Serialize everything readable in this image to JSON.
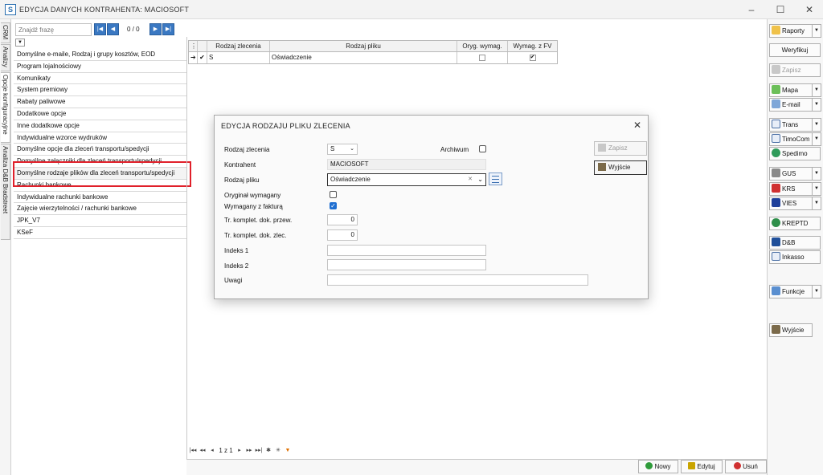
{
  "window": {
    "title": "EDYCJA DANYCH KONTRAHENTA: MACIOSOFT",
    "app_icon": "S"
  },
  "vtabs": [
    "CRM",
    "Analizy",
    "Opcje konfiguracyjne",
    "Analiza D&B Bradstreet"
  ],
  "search": {
    "placeholder": "Znajdź frazę",
    "count": "0 / 0"
  },
  "left_list": [
    "Domyślne e-maile, Rodzaj i grupy kosztów, EOD",
    "Program lojalnościowy",
    "Komunikaty",
    "System premiowy",
    "Rabaty paliwowe",
    "Dodatkowe opcje",
    "Inne dodatkowe opcje",
    "Indywidualne wzorce wydruków",
    "Domyślne opcje dla zleceń transportu/spedycji",
    "Domyślne załączniki dla zleceń transportu/spedycji",
    "Domyślne rodzaje plików dla zleceń transportu/spedycji",
    "Rachunki bankowe",
    "Indywidualne rachunki bankowe",
    "Zajęcie wierzytelności / rachunki bankowe",
    "JPK_V7",
    "KSeF"
  ],
  "grid": {
    "headers": [
      "",
      "",
      "Rodzaj zlecenia",
      "Rodzaj pliku",
      "Oryg. wymag.",
      "Wymag. z FV"
    ],
    "rows": [
      {
        "marker": "➔",
        "check": "✔",
        "rodzaj_zlecenia": "S",
        "rodzaj_pliku": "Oświadczenie",
        "oryg": false,
        "fv": true
      }
    ]
  },
  "bottom_nav": {
    "page": "1 z 1"
  },
  "bottom_buttons": {
    "new": "Nowy",
    "edit": "Edytuj",
    "delete": "Usuń"
  },
  "right_toolbar": {
    "raporty": "Raporty",
    "weryfikuj": "Weryfikuj",
    "zapisz": "Zapisz",
    "mapa": "Mapa",
    "email": "E-mail",
    "trans": "Trans",
    "timocom": "TimoCom",
    "spedimo": "Spedimo",
    "gus": "GUS",
    "krs": "KRS",
    "vies": "VIES",
    "kreptd": "KREPTD",
    "db": "D&B",
    "inkasso": "Inkasso",
    "funkcje": "Funkcje",
    "wyjscie": "Wyjście"
  },
  "modal": {
    "title": "EDYCJA RODZAJU PLIKU ZLECENIA",
    "rodzaj_zlecenia_label": "Rodzaj zlecenia",
    "rodzaj_zlecenia_value": "S",
    "archiwum_label": "Archiwum",
    "archiwum": false,
    "kontrahent_label": "Kontrahent",
    "kontrahent_value": "MACIOSOFT",
    "rodzaj_pliku_label": "Rodzaj pliku",
    "rodzaj_pliku_value": "Oświadczenie",
    "oryginal_label": "Oryginał wymagany",
    "oryginal": false,
    "faktura_label": "Wymagany z fakturą",
    "faktura": true,
    "tr_przew_label": "Tr. komplet. dok. przew.",
    "tr_przew_value": "0",
    "tr_zlec_label": "Tr. komplet. dok. zlec.",
    "tr_zlec_value": "0",
    "indeks1_label": "Indeks 1",
    "indeks1_value": "",
    "indeks2_label": "Indeks 2",
    "indeks2_value": "",
    "uwagi_label": "Uwagi",
    "uwagi_value": "",
    "zapisz_label": "Zapisz",
    "wyjscie_label": "Wyjście"
  },
  "colors": {
    "accent": "#3a78c2",
    "highlight": "#e0202a",
    "check": "#1f6fd1"
  }
}
